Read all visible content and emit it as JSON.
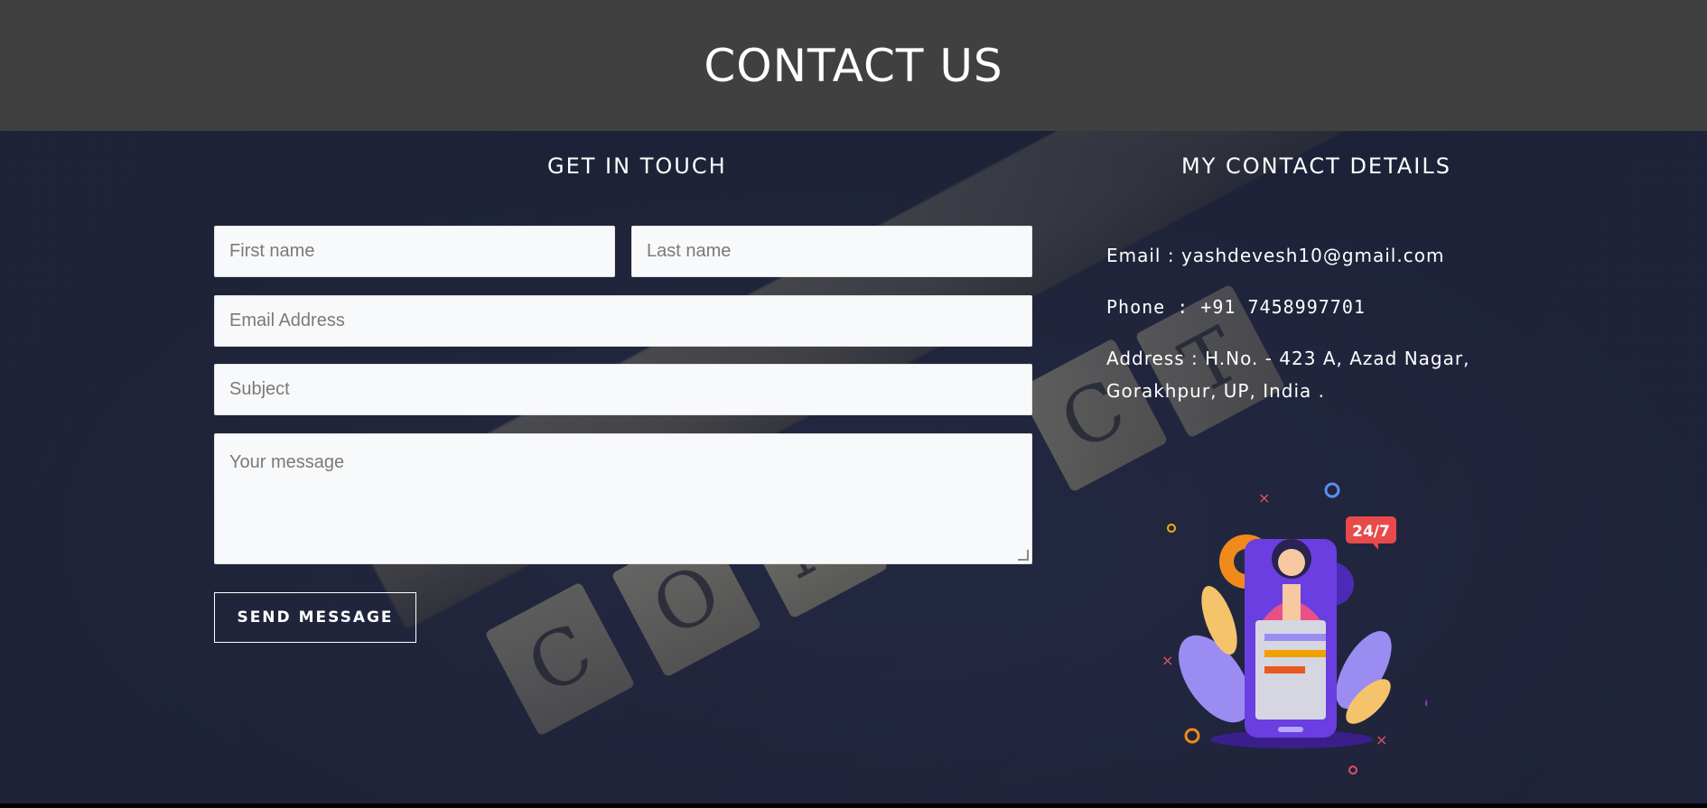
{
  "header": {
    "title": "CONTACT US"
  },
  "form": {
    "title": "GET  IN  TOUCH",
    "first_name_placeholder": "First name",
    "last_name_placeholder": "Last name",
    "email_placeholder": "Email Address",
    "subject_placeholder": "Subject",
    "message_placeholder": "Your message",
    "send_label": "SEND MESSAGE"
  },
  "details": {
    "title": "MY  CONTACT  DETAILS",
    "email": "Email : yashdevesh10@gmail.com",
    "phone": "Phone : +91 7458997701",
    "address_line1": "Address : H.No. - 423 A, Azad Nagar,",
    "address_line2": "Gorakhpur, UP, India ."
  },
  "illustration": {
    "badge": "24/7"
  },
  "colors": {
    "header_bg": "#404040",
    "main_bg": "#252a43",
    "accent_orange": "#f08a1c",
    "accent_purple": "#6a3ee0"
  }
}
